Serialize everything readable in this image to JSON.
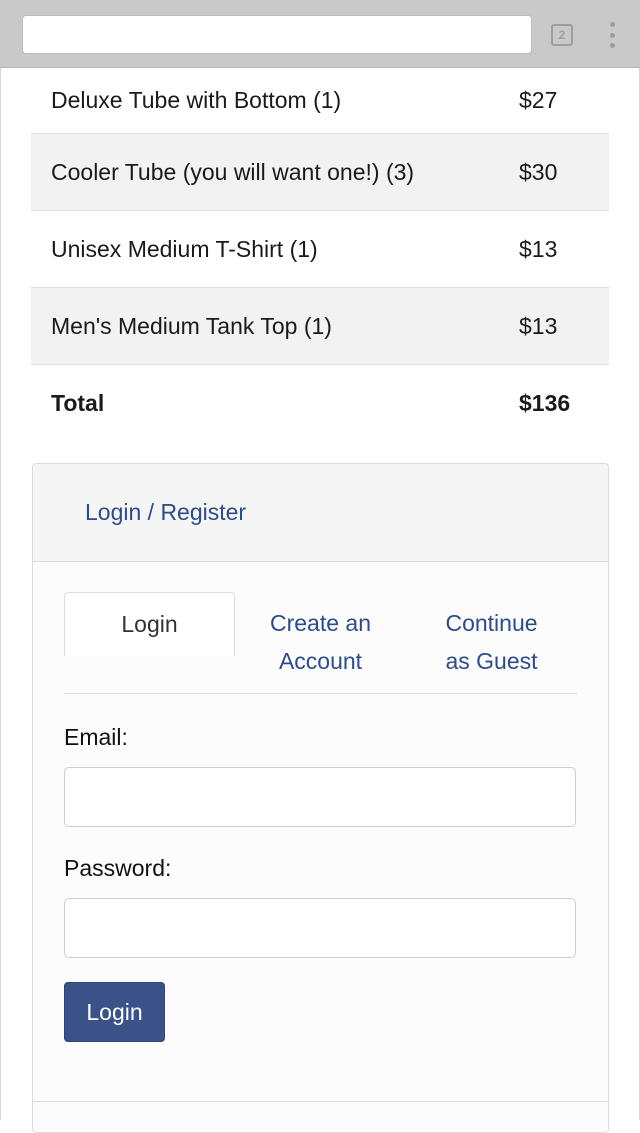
{
  "browser": {
    "url": "",
    "tab_count": "2"
  },
  "cart": {
    "items": [
      {
        "name": "Deluxe Tube with Bottom (1)",
        "price": "$27"
      },
      {
        "name": "Cooler Tube (you will want one!) (3)",
        "price": "$30"
      },
      {
        "name": "Unisex Medium T-Shirt (1)",
        "price": "$13"
      },
      {
        "name": "Men's Medium Tank Top (1)",
        "price": "$13"
      }
    ],
    "total_label": "Total",
    "total_value": "$136"
  },
  "login_panel": {
    "heading": "Login / Register",
    "tabs": [
      {
        "label_line1": "Login",
        "label_line2": "",
        "active": true
      },
      {
        "label_line1": "Create an",
        "label_line2": "Account",
        "active": false
      },
      {
        "label_line1": "Continue",
        "label_line2": "as Guest",
        "active": false
      }
    ],
    "email_label": "Email:",
    "email_value": "",
    "password_label": "Password:",
    "password_value": "",
    "submit_label": "Login"
  },
  "colors": {
    "link": "#2e4c86",
    "button": "#3a5288",
    "row_alt": "#f2f2f2"
  }
}
